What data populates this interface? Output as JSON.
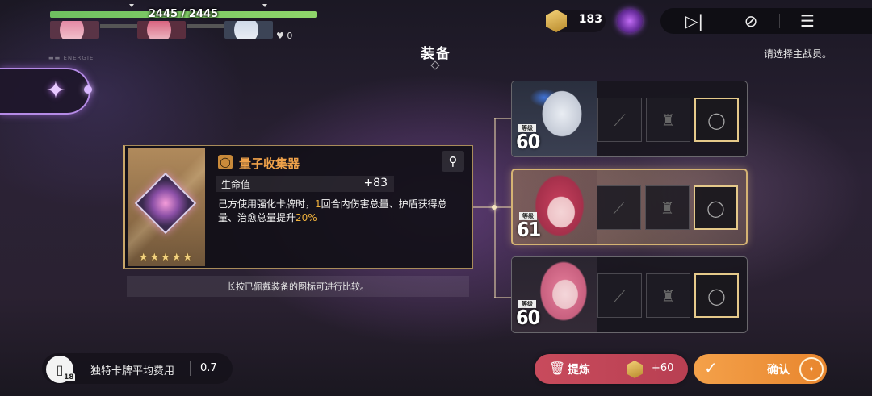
{
  "party": {
    "hp_text": "2445 / 2445",
    "hp_fraction": 1.0,
    "shield_count": "0"
  },
  "topbar": {
    "coin_count": "183",
    "skip_icon": "skip-forward-icon",
    "auto_icon": "auto-play-off-icon",
    "menu_icon": "menu-icon"
  },
  "header": {
    "title": "装备",
    "hint": "请选择主战员。",
    "hud_tiny": "▬▬ ENERGIE"
  },
  "equipment": {
    "name": "量子收集器",
    "rarity_stars": "★★★★★",
    "stat_label": "生命值",
    "stat_value": "+83",
    "desc_a": "己方使用强化卡牌时，",
    "desc_b": "1",
    "desc_c": "回合内伤害总量、护盾获得总量、治愈总量提升",
    "desc_d": "20%",
    "compare_hint": "长按已佩戴装备的图标可进行比较。"
  },
  "characters": [
    {
      "level_tag": "等级",
      "level": "60",
      "selected": false
    },
    {
      "level_tag": "等级",
      "level": "61",
      "selected": true
    },
    {
      "level_tag": "等级",
      "level": "60",
      "selected": false
    }
  ],
  "footer": {
    "deck_count": "18",
    "cost_label": "独特卡牌平均费用",
    "cost_value": "0.7",
    "refine_label": "提炼",
    "refine_amount": "+60",
    "confirm_label": "确认"
  },
  "colors": {
    "hp_green": "#7fcb66",
    "item_orange": "#f0a24a",
    "highlight": "#f2b33d",
    "refine_red": "#c84b5c",
    "confirm_orange": "#f0993f",
    "selected_gold": "#d5b373"
  }
}
